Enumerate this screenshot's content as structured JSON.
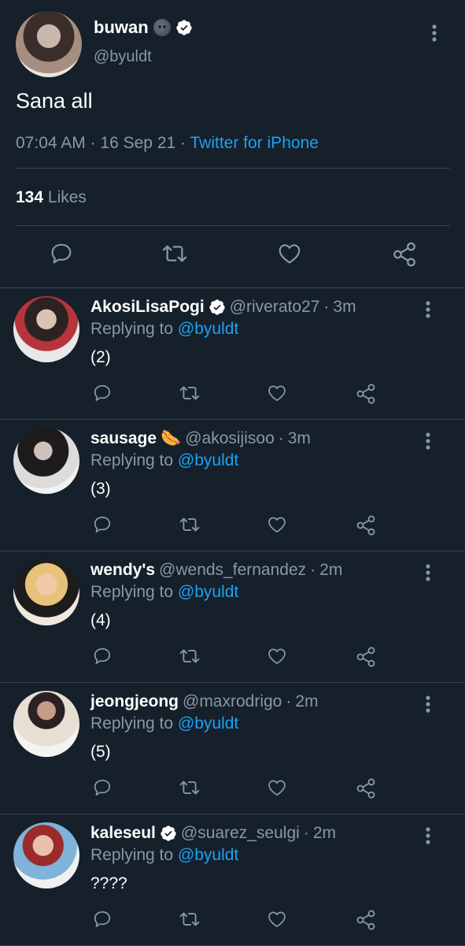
{
  "tweet": {
    "display_name": "buwan",
    "emoji": "🌚",
    "handle": "@byuldt",
    "text": "Sana all",
    "time": "07:04 AM",
    "date": "16 Sep 21",
    "source": "Twitter for iPhone",
    "likes_count": "134",
    "likes_label": "Likes"
  },
  "replies": [
    {
      "name": "AkosiLisaPogi",
      "verified": true,
      "handle": "@riverato27",
      "time": "3m",
      "replying_label": "Replying to",
      "replying_to": "@byuldt",
      "text": "(2)"
    },
    {
      "name": "sausage",
      "emoji": "🌭",
      "handle": "@akosijisoo",
      "time": "3m",
      "replying_label": "Replying to",
      "replying_to": "@byuldt",
      "text": "(3)"
    },
    {
      "name": "wendy's",
      "handle": "@wends_fernandez",
      "time": "2m",
      "replying_label": "Replying to",
      "replying_to": "@byuldt",
      "text": "(4)"
    },
    {
      "name": "jeongjeong",
      "handle": "@maxrodrigo",
      "time": "2m",
      "replying_label": "Replying to",
      "replying_to": "@byuldt",
      "text": "(5)"
    },
    {
      "name": "kaleseul",
      "verified": true,
      "handle": "@suarez_seulgi",
      "time": "2m",
      "replying_label": "Replying to",
      "replying_to": "@byuldt",
      "text": "????"
    }
  ],
  "separator": "·",
  "icons": [
    "reply-icon",
    "retweet-icon",
    "like-icon",
    "share-icon",
    "more-icon",
    "verified-badge-icon"
  ],
  "colors": {
    "background": "#15202b",
    "accent": "#1da1f2",
    "muted": "#8899a6",
    "divider": "#38444d"
  }
}
